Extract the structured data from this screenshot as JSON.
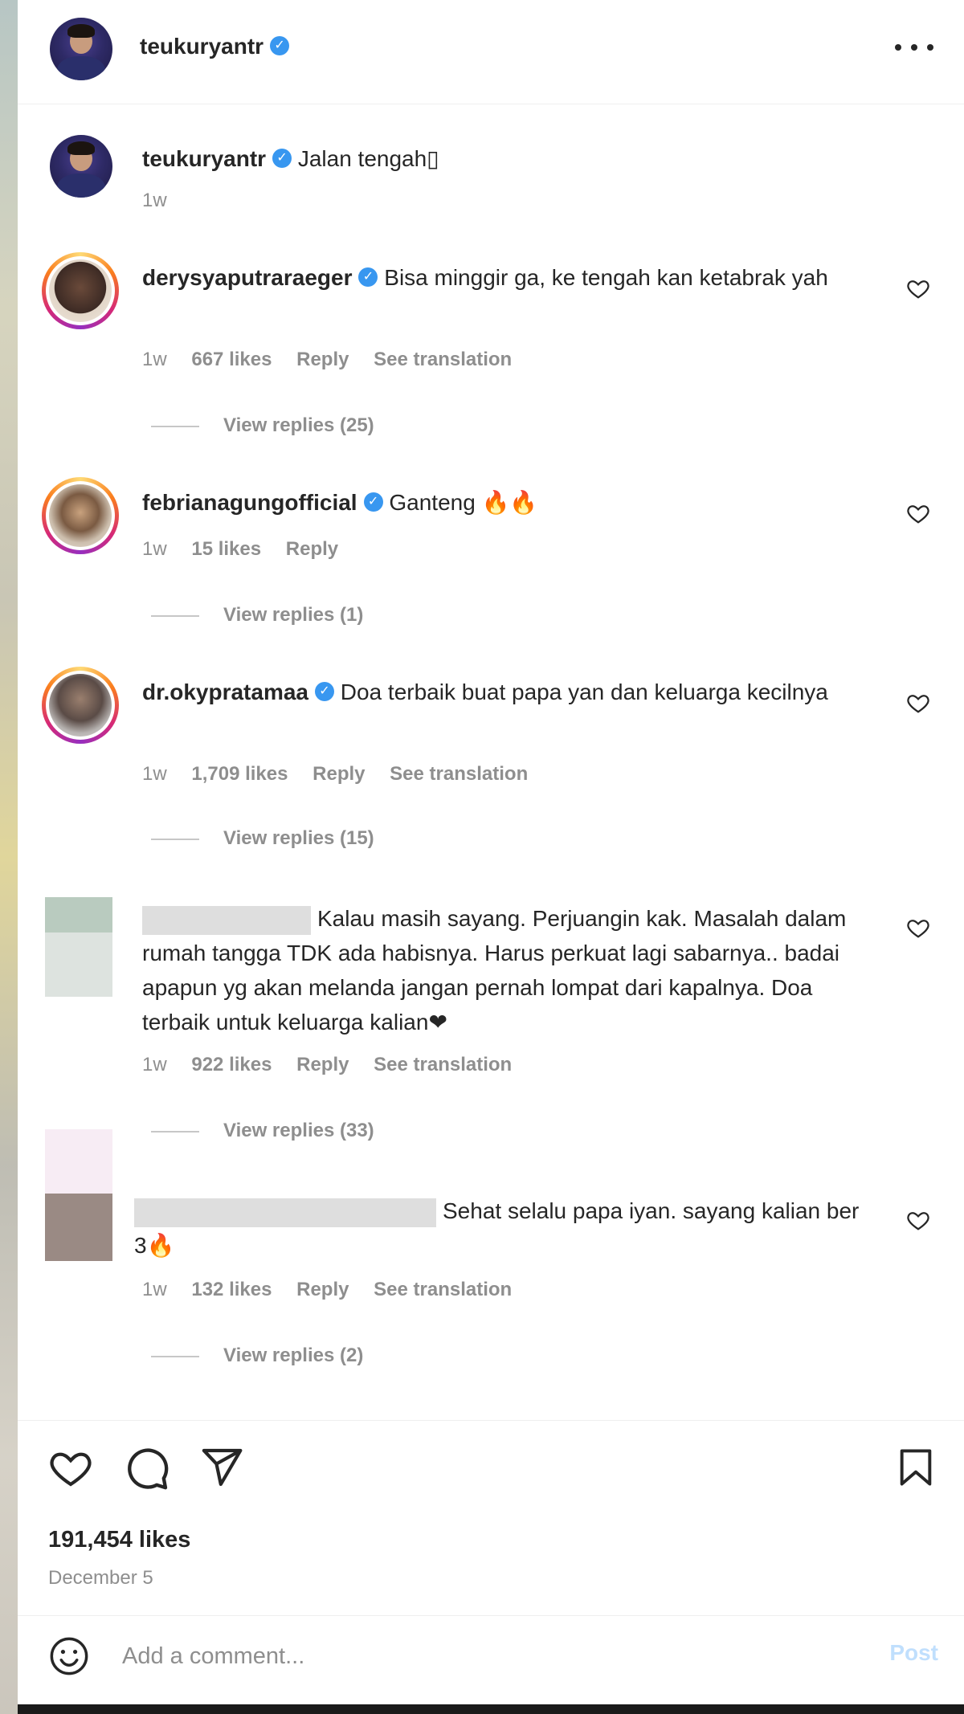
{
  "header": {
    "username": "teukuryantr",
    "verified_mark": "✓",
    "more_icon": "more-horizontal-icon"
  },
  "caption": {
    "username": "teukuryantr",
    "text": "Jalan tengah▯",
    "time": "1w"
  },
  "comments": [
    {
      "username": "derysyaputraraeger",
      "verified": true,
      "text": "Bisa minggir ga, ke tengah kan ketabrak yah",
      "time": "1w",
      "likes": "667 likes",
      "reply": "Reply",
      "translation": "See translation",
      "view_replies": "View replies (25)"
    },
    {
      "username": "febrianagungofficial",
      "verified": true,
      "text": "Ganteng 🔥🔥",
      "time": "1w",
      "likes": "15 likes",
      "reply": "Reply",
      "view_replies": "View replies (1)"
    },
    {
      "username": "dr.okypratamaa",
      "verified": true,
      "text": "Doa terbaik buat papa yan dan keluarga kecilnya",
      "time": "1w",
      "likes": "1,709 likes",
      "reply": "Reply",
      "translation": "See translation",
      "view_replies": "View replies (15)"
    },
    {
      "username": "",
      "verified": false,
      "text": "Kalau masih sayang. Perjuangin kak. Masalah dalam rumah tangga TDK ada habisnya. Harus perkuat lagi sabarnya.. badai apapun yg akan melanda jangan pernah lompat dari kapalnya. Doa terbaik untuk keluarga kalian❤",
      "time": "1w",
      "likes": "922 likes",
      "reply": "Reply",
      "translation": "See translation",
      "view_replies": "View replies (33)"
    },
    {
      "username": "",
      "verified": false,
      "text": "Sehat selalu papa iyan. sayang kalian ber 3🔥",
      "time": "1w",
      "likes": "132 likes",
      "reply": "Reply",
      "translation": "See translation",
      "view_replies": "View replies (2)"
    }
  ],
  "actions": {
    "like_icon": "heart-icon",
    "comment_icon": "comment-icon",
    "share_icon": "share-icon",
    "save_icon": "bookmark-icon"
  },
  "likes_total": "191,454 likes",
  "post_date": "December 5",
  "add_comment": {
    "placeholder": "Add a comment...",
    "post_label": "Post",
    "emoji_icon": "emoji-icon"
  },
  "colors": {
    "verified": "#3897f0",
    "muted_text": "#8e8e8e",
    "post_disabled": "#c0dffd"
  }
}
